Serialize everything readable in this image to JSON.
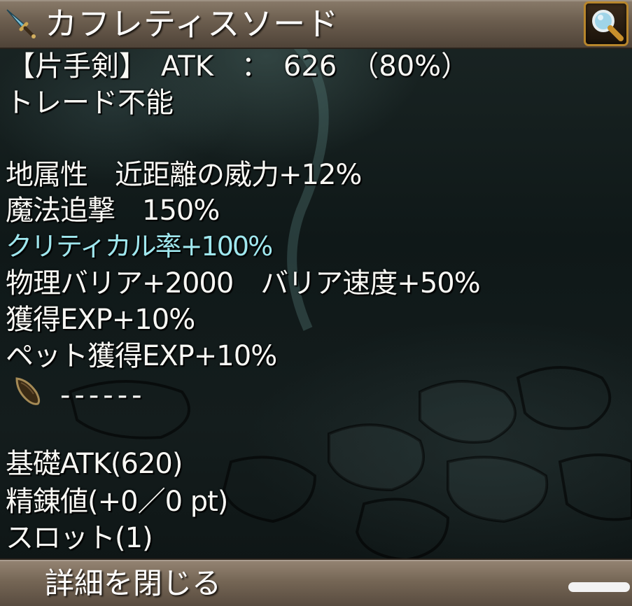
{
  "title_bar": {
    "item_name": "カフレティスソード",
    "item_icon": "sword-icon",
    "search_icon": "magnifier-icon"
  },
  "stats": {
    "weapon_line": "【片手剣】　ATK　：　626　（80%）",
    "trade_line": "トレード不能",
    "lines": [
      "地属性　近距離の威力+12%",
      "魔法追撃　150%",
      "クリティカル率+100%",
      "物理バリア+2000　バリア速度+50%",
      "獲得EXP+10%",
      "ペット獲得EXP+10%"
    ],
    "highlight_color": "#9fe7ee"
  },
  "slot": {
    "icon": "card-slot-icon",
    "value": "------"
  },
  "info": {
    "base_atk": "基礎ATK(620)",
    "refine": "精錬値(+0／0 pt)",
    "slots": "スロット(1)"
  },
  "footer": {
    "close_label": "詳細を閉じる"
  },
  "colors": {
    "frame": "#6b5d4e",
    "accent_gold": "#b8862c"
  }
}
